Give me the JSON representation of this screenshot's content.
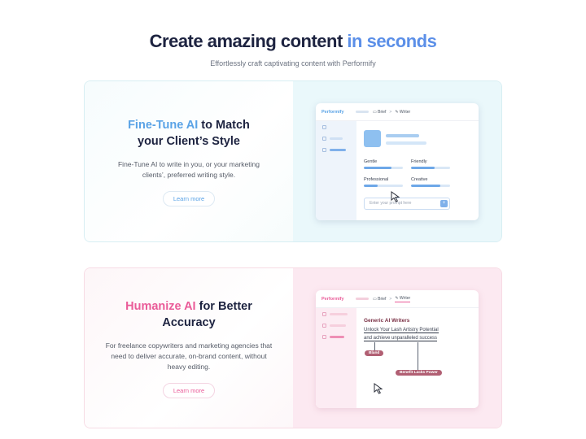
{
  "hero": {
    "title_main": "Create amazing content ",
    "title_accent": "in seconds",
    "subtitle": "Effortlessly craft captivating content with Performify"
  },
  "cards": [
    {
      "title_accent": "Fine-Tune AI",
      "title_rest_1": " to Match",
      "title_rest_2": "your Client’s Style",
      "description": "Fine-Tune AI to write in you, or your marketing clients’, preferred writing style.",
      "button": "Learn more",
      "mock": {
        "logo": "Performify",
        "tab_brief": "Brief",
        "tab_writer": "Writer",
        "separator": ">",
        "tones": [
          {
            "label": "Gentle",
            "level": 0.7
          },
          {
            "label": "Friendly",
            "level": 0.6
          },
          {
            "label": "Professional",
            "level": 0.35
          },
          {
            "label": "Creative",
            "level": 0.75
          }
        ],
        "prompt_placeholder": "Enter your prompt here",
        "send_symbol": "+"
      }
    },
    {
      "title_accent": "Humanize AI",
      "title_rest_1": " for Better",
      "title_rest_2": "Accuracy",
      "description": "For freelance copywriters and marketing agencies that need to deliver accurate, on-brand content, without heavy editing.",
      "button": "Learn more",
      "mock": {
        "logo": "Performify",
        "tab_brief": "Brief",
        "tab_writer": "Writer",
        "separator": ">",
        "doc_title": "Generic AI Writers",
        "doc_line_1": "Unlock Your Lash Artistry Potential",
        "doc_line_2": "and achieve unparalleled success",
        "tag_1": "Bland",
        "tag_2": "Benefit Lacks Power"
      }
    }
  ],
  "colors": {
    "title": "#1d2340",
    "accent_blue": "#5b8fe8",
    "accent_pink": "#ea5b98"
  }
}
